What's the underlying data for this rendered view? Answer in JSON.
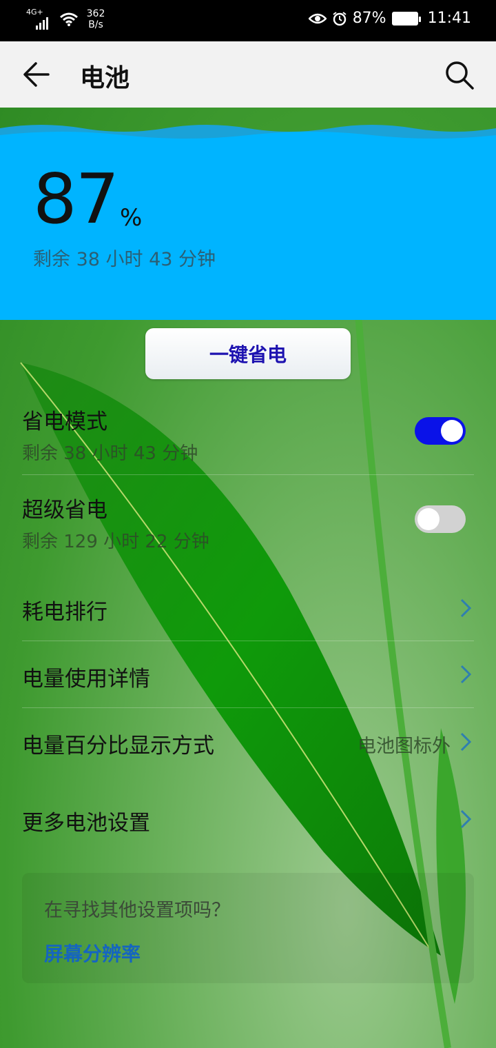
{
  "status_bar": {
    "network_type": "4G+",
    "net_speed_value": "362",
    "net_speed_unit": "B/s",
    "battery_percent": "87%",
    "time": "11:41"
  },
  "app_bar": {
    "title": "电池"
  },
  "battery": {
    "level": "87",
    "percent_sign": "%",
    "remaining": "剩余 38 小时 43 分钟",
    "banner_color": "#00b4ff"
  },
  "one_key_save": {
    "label": "一键省电"
  },
  "settings": {
    "power_saving": {
      "title": "省电模式",
      "subtitle": "剩余 38 小时 43 分钟",
      "enabled": true
    },
    "ultra_saving": {
      "title": "超级省电",
      "subtitle": "剩余 129 小时 22 分钟",
      "enabled": false
    },
    "ranking": {
      "title": "耗电排行"
    },
    "usage_details": {
      "title": "电量使用详情"
    },
    "percentage_display": {
      "title": "电量百分比显示方式",
      "value": "电池图标外"
    },
    "more_settings": {
      "title": "更多电池设置"
    }
  },
  "suggestion": {
    "question": "在寻找其他设置项吗？",
    "link": "屏幕分辨率"
  },
  "colors": {
    "toggle_on": "#0a12e8",
    "link": "#1565c0"
  }
}
